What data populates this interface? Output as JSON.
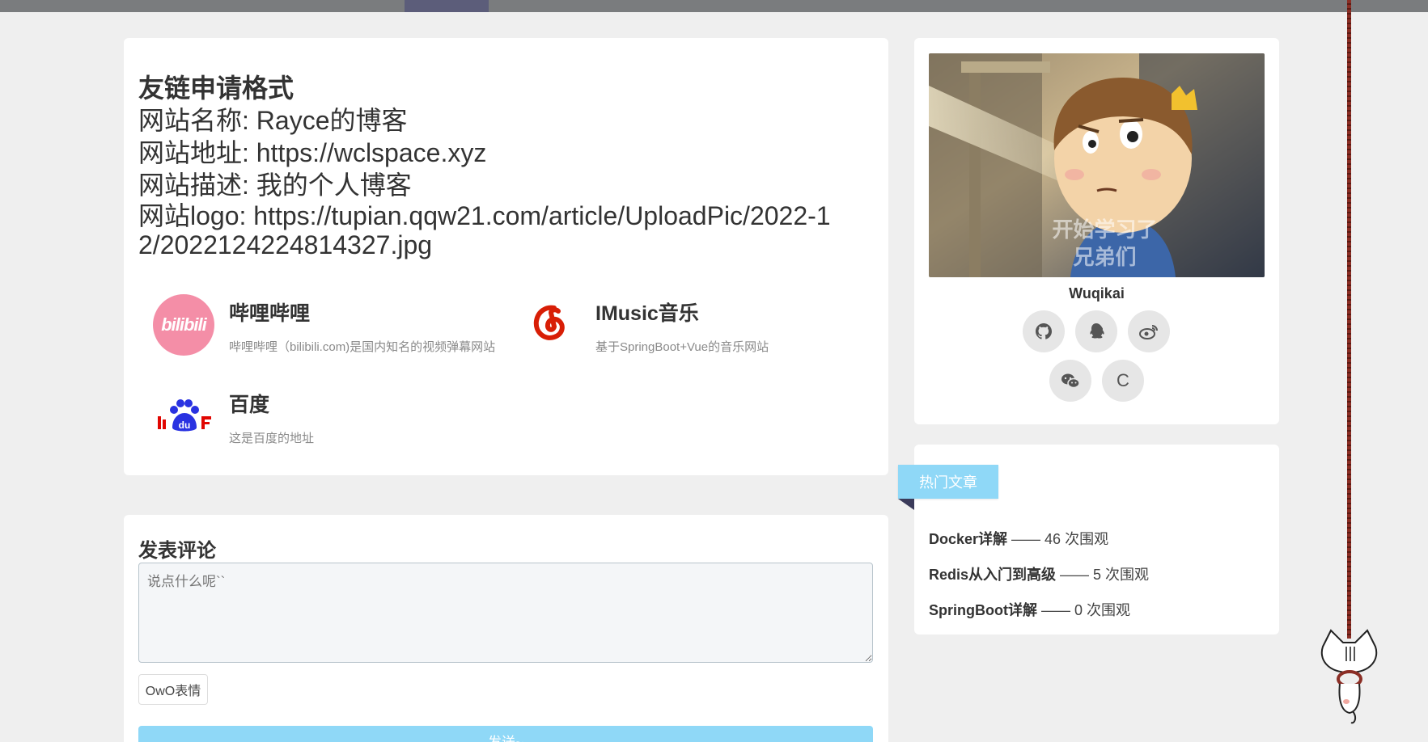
{
  "apply": {
    "title": "友链申请格式",
    "name_line": "网站名称: Rayce的博客",
    "url_line": "网站地址: https://wclspace.xyz",
    "desc_line": "网站描述: 我的个人博客",
    "logo_line": "网站logo: https://tupian.qqw21.com/article/UploadPic/2022-12/2022124224814327.jpg"
  },
  "friends": [
    {
      "name": "哔哩哔哩",
      "desc": "哔哩哔哩（bilibili.com)是国内知名的视频弹幕网站",
      "logo_icon": "bilibili-logo",
      "logo_text": "bilibili"
    },
    {
      "name": "IMusic音乐",
      "desc": "基于SpringBoot+Vue的音乐网站",
      "logo_icon": "netease-music-logo"
    },
    {
      "name": "百度",
      "desc": "这是百度的地址",
      "logo_icon": "baidu-logo"
    }
  ],
  "comment": {
    "title": "发表评论",
    "placeholder": "说点什么呢``",
    "owo_label": "OwO表情",
    "send_label": "发送~"
  },
  "profile": {
    "name": "Wuqikai",
    "image_caption": "开始学习了兄弟们",
    "socials": [
      {
        "icon": "github-icon"
      },
      {
        "icon": "qq-icon"
      },
      {
        "icon": "weibo-icon"
      },
      {
        "icon": "wechat-icon"
      },
      {
        "icon": "csdn-icon",
        "label": "C"
      }
    ]
  },
  "hot": {
    "ribbon": "热门文章",
    "items": [
      {
        "title": "Docker详解",
        "views": "—— 46 次围观"
      },
      {
        "title": "Redis从入门到高级",
        "views": "—— 5 次围观"
      },
      {
        "title": "SpringBoot详解",
        "views": "—— 0 次围观"
      }
    ]
  },
  "colors": {
    "accent": "#8fd8f7",
    "topbar": "#7a7c7e",
    "topbar_active": "#5c5d7a",
    "bilibili": "#f48ea7",
    "netease": "#d81e06"
  }
}
